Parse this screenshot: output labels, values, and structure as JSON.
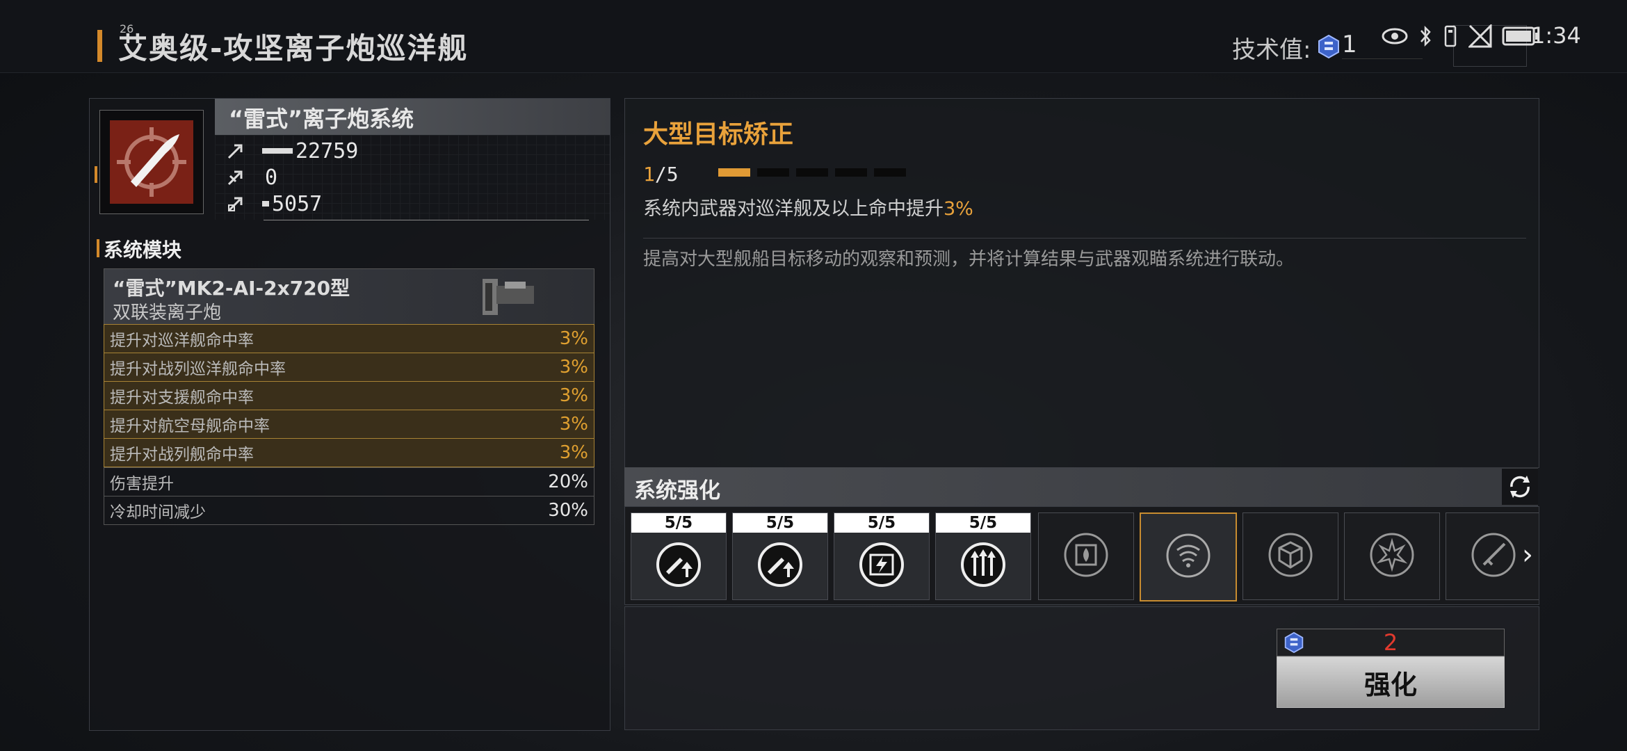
{
  "header": {
    "status_number": "26",
    "title": "艾奥级-攻坚离子炮巡洋舰",
    "tech_label": "技术值:",
    "tech_value": "1",
    "time": "1:34"
  },
  "system": {
    "name": "“雷式”离子炮系统",
    "stats": [
      {
        "icon": "damage-icon",
        "value": "22759",
        "bar": 0.85
      },
      {
        "icon": "range-icon",
        "value": "0",
        "bar": 0.0
      },
      {
        "icon": "armor-pierce-icon",
        "value": "5057",
        "bar": 0.2
      }
    ]
  },
  "modules": {
    "title": "系统模块",
    "card_name": "“雷式”MK2-AI-2x720型",
    "card_sub": "双联装离子炮",
    "effects": [
      {
        "label": "提升对巡洋舰命中率",
        "value": "3%",
        "highlight": true
      },
      {
        "label": "提升对战列巡洋舰命中率",
        "value": "3%",
        "highlight": true
      },
      {
        "label": "提升对支援舰命中率",
        "value": "3%",
        "highlight": true
      },
      {
        "label": "提升对航空母舰命中率",
        "value": "3%",
        "highlight": true
      },
      {
        "label": "提升对战列舰命中率",
        "value": "3%",
        "highlight": true
      },
      {
        "label": "伤害提升",
        "value": "20%",
        "highlight": false
      },
      {
        "label": "冷却时间减少",
        "value": "30%",
        "highlight": false
      }
    ]
  },
  "bonus": {
    "title": "大型目标矫正",
    "level_current": "1",
    "level_max": "/5",
    "pips_filled": 1,
    "pips_total": 5,
    "desc_prefix": "系统内武器对巡洋舰及以上命中提升",
    "desc_value": "3%",
    "flavor": "提高对大型舰船目标移动的观察和预测，并将计算结果与武器观瞄系统进行联动。"
  },
  "enhance": {
    "title": "系统强化",
    "slots": [
      {
        "label": "5/5",
        "icon": "missile-up-icon",
        "state": "maxed"
      },
      {
        "label": "5/5",
        "icon": "missile-up-icon",
        "state": "maxed"
      },
      {
        "label": "5/5",
        "icon": "energy-card-icon",
        "state": "maxed"
      },
      {
        "label": "5/5",
        "icon": "triple-arrow-icon",
        "state": "maxed"
      },
      {
        "label": "",
        "icon": "chip-fire-icon",
        "state": "locked"
      },
      {
        "label": "",
        "icon": "radar-icon",
        "state": "selected"
      },
      {
        "label": "",
        "icon": "cube-icon",
        "state": "locked"
      },
      {
        "label": "",
        "icon": "burst-icon",
        "state": "locked"
      },
      {
        "label": "",
        "icon": "rocket-icon",
        "state": "locked"
      }
    ],
    "cost": "2",
    "button_label": "强化"
  }
}
